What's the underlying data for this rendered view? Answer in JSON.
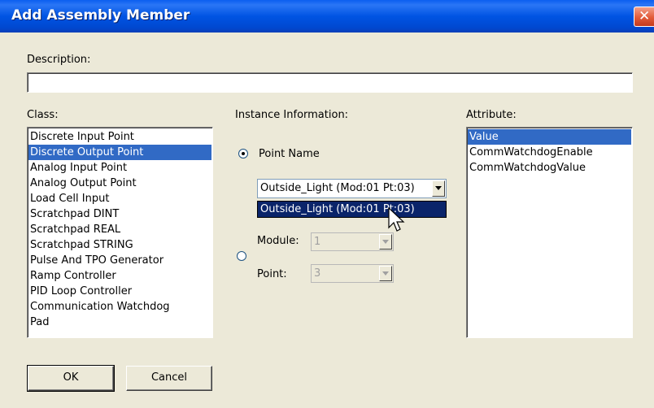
{
  "dialog": {
    "title": "Add Assembly Member"
  },
  "description": {
    "label": "Description:",
    "value": ""
  },
  "class_list": {
    "label": "Class:",
    "items": [
      "Discrete Input Point",
      "Discrete Output Point",
      "Analog Input Point",
      "Analog Output Point",
      "Load Cell Input",
      "Scratchpad DINT",
      "Scratchpad REAL",
      "Scratchpad STRING",
      "Pulse And TPO Generator",
      "Ramp Controller",
      "PID Loop Controller",
      "Communication Watchdog",
      "Pad"
    ],
    "selected": "Discrete Output Point"
  },
  "instance": {
    "label": "Instance Information:",
    "point_name_label": "Point Name",
    "point_name_value": "Outside_Light  (Mod:01 Pt:03)",
    "dropdown_item": "Outside_Light  (Mod:01 Pt:03)",
    "module_label": "Module:",
    "module_value": "1",
    "point_label": "Point:",
    "point_value": "3"
  },
  "attribute_list": {
    "label": "Attribute:",
    "items": [
      "Value",
      "CommWatchdogEnable",
      "CommWatchdogValue"
    ],
    "selected": "Value"
  },
  "buttons": {
    "ok": "OK",
    "cancel": "Cancel"
  }
}
